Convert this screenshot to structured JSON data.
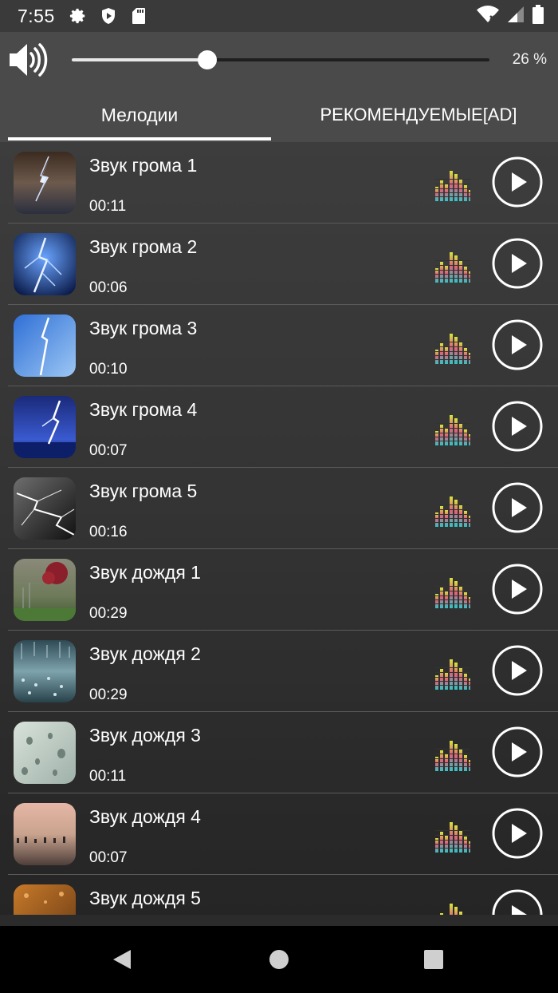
{
  "status_bar": {
    "time": "7:55",
    "icons": [
      "gear-icon",
      "shield-play-icon",
      "sd-card-icon"
    ],
    "right_icons": [
      "wifi-icon",
      "signal-icon",
      "battery-icon"
    ]
  },
  "volume": {
    "icon": "speaker-icon",
    "level": 0.26,
    "label": "26 %"
  },
  "tabs": [
    {
      "label": "Мелодии",
      "active": true
    },
    {
      "label": "РЕКОМЕНДУЕМЫЕ[AD]",
      "active": false
    }
  ],
  "items": [
    {
      "title": "Звук грома 1",
      "duration": "00:11"
    },
    {
      "title": "Звук грома 2",
      "duration": "00:06"
    },
    {
      "title": "Звук грома 3",
      "duration": "00:10"
    },
    {
      "title": "Звук грома 4",
      "duration": "00:07"
    },
    {
      "title": "Звук грома 5",
      "duration": "00:16"
    },
    {
      "title": "Звук дождя 1",
      "duration": "00:29"
    },
    {
      "title": "Звук дождя 2",
      "duration": "00:29"
    },
    {
      "title": "Звук дождя 3",
      "duration": "00:11"
    },
    {
      "title": "Звук дождя 4",
      "duration": "00:07"
    },
    {
      "title": "Звук дождя 5",
      "duration": ""
    }
  ],
  "nav": [
    "back-icon",
    "home-icon",
    "recents-icon"
  ],
  "colors": {
    "background": "#2b2b2b",
    "bar": "#4a4a4a",
    "accent": "#ffffff"
  }
}
